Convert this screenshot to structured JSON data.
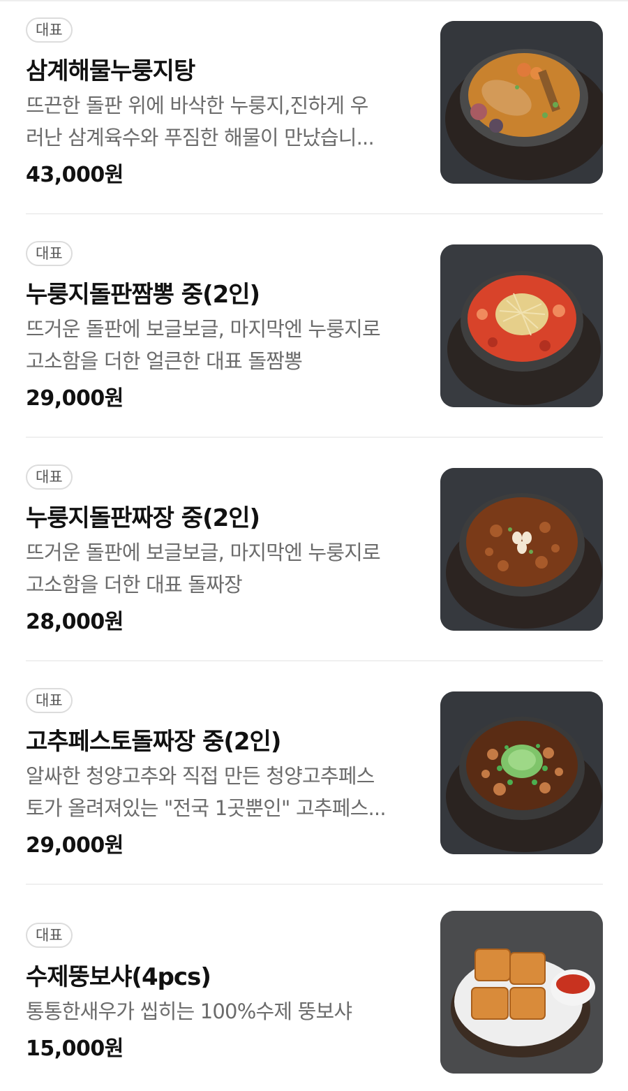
{
  "menu": {
    "items": [
      {
        "badge": "대표",
        "name": "삼계해물누룽지탕",
        "desc_line1": "뜨끈한 돌판 위에 바삭한 누룽지,진하게 우",
        "desc_line2": "러난 삼계육수와 푸짐한 해물이 만났습니...",
        "price": "43,000원",
        "image": "samgye-seafood-nurungji-soup-photo"
      },
      {
        "badge": "대표",
        "name": "누룽지돌판짬뽕 중(2인)",
        "desc_line1": "뜨거운 돌판에 보글보글, 마지막엔 누룽지로",
        "desc_line2": "고소함을 더한 얼큰한 대표 돌짬뽕",
        "price": "29,000원",
        "image": "nurungji-stone-jjamppong-photo"
      },
      {
        "badge": "대표",
        "name": "누룽지돌판짜장 중(2인)",
        "desc_line1": "뜨거운 돌판에 보글보글, 마지막엔 누룽지로",
        "desc_line2": "고소함을 더한 대표 돌짜장",
        "price": "28,000원",
        "image": "nurungji-stone-jjajang-photo"
      },
      {
        "badge": "대표",
        "name": "고추페스토돌짜장 중(2인)",
        "desc_line1": "알싸한 청양고추와 직접 만든 청양고추페스",
        "desc_line2": "토가 올려져있는 \"전국 1곳뿐인\" 고추페스...",
        "price": "29,000원",
        "image": "pepper-pesto-stone-jjajang-photo"
      },
      {
        "badge": "대표",
        "name": "수제뚱보샤(4pcs)",
        "desc_line1": "통통한새우가 씹히는 100%수제 뚱보샤",
        "desc_line2": "",
        "price": "15,000원",
        "image": "shrimp-toast-photo"
      }
    ]
  },
  "colors": {
    "badge_border": "#dcdcdc",
    "text_primary": "#111111",
    "text_secondary": "#6b6b6b",
    "divider": "#f0f0f0"
  }
}
